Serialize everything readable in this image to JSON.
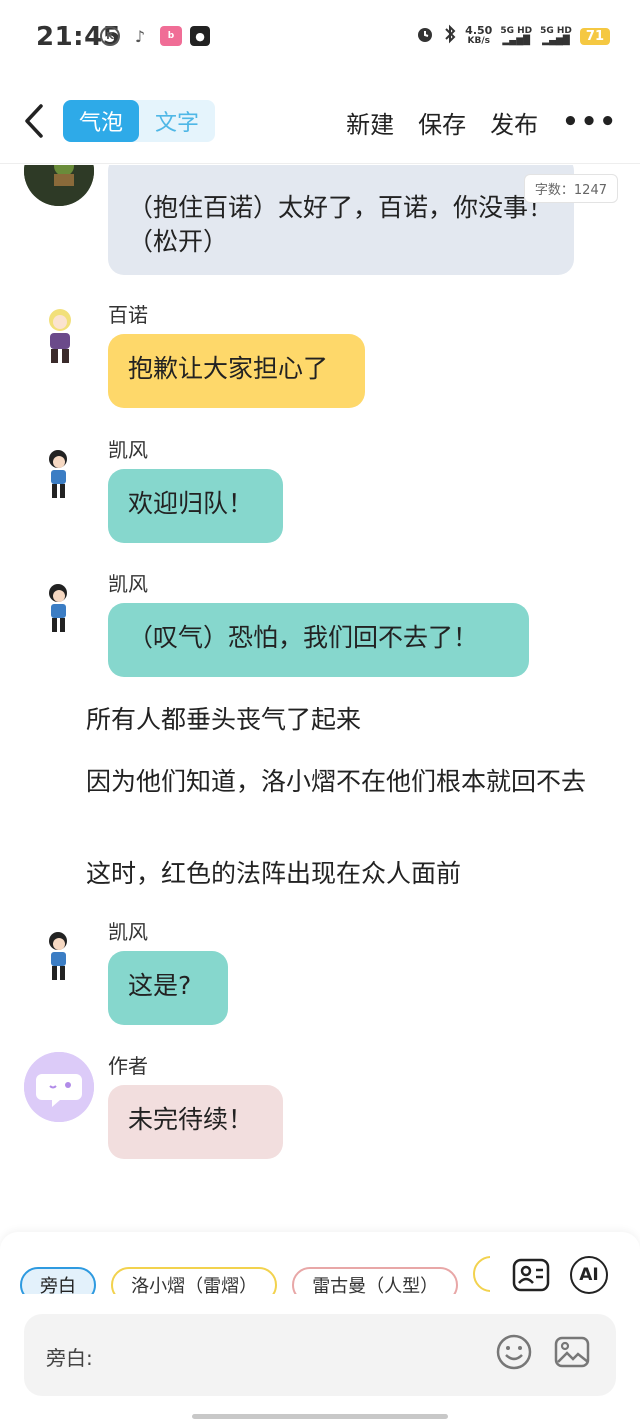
{
  "status": {
    "time": "21:45",
    "speed_value": "4.50",
    "speed_unit": "KB/s",
    "sig1": "5G HD",
    "sig2": "5G HD",
    "battery": "71"
  },
  "header": {
    "mode_bubble": "气泡",
    "mode_text": "文字",
    "new_label": "新建",
    "save_label": "保存",
    "publish_label": "发布",
    "more_label": "•••"
  },
  "word_count": "字数：1247",
  "messages": [
    {
      "type": "bubble",
      "text": "（抱住百诺）太好了，百诺，你没事！（松开）",
      "color": "#e3e8f0"
    },
    {
      "type": "bubble",
      "speaker": "百诺",
      "text": "抱歉让大家担心了",
      "color": "#fed86a"
    },
    {
      "type": "bubble",
      "speaker": "凯风",
      "text": "欢迎归队！",
      "color": "#86d7cd"
    },
    {
      "type": "bubble",
      "speaker": "凯风",
      "text": "（叹气）恐怕，我们回不去了！",
      "color": "#86d7cd"
    },
    {
      "type": "narration",
      "text": "所有人都垂头丧气了起来"
    },
    {
      "type": "narration",
      "text": "因为他们知道，洛小熠不在他们根本就回不去"
    },
    {
      "type": "narration",
      "text": "这时，红色的法阵出现在众人面前"
    },
    {
      "type": "bubble",
      "speaker": "凯风",
      "text": "这是?",
      "color": "#86d7cd"
    },
    {
      "type": "bubble",
      "speaker": "作者",
      "text": "未完待续！",
      "color": "#f2dede"
    }
  ],
  "chips": [
    "旁白",
    "洛小熠（雷熠）",
    "雷古曼（人型）"
  ],
  "tools": {
    "ai_label": "AI"
  },
  "input": {
    "label": "旁白:",
    "placeholder": ""
  },
  "colors": {
    "accent": "#2eaae8",
    "bubble_kaifeng": "#86d7cd",
    "bubble_bainuo": "#fed86a",
    "bubble_author": "#f2dede"
  }
}
